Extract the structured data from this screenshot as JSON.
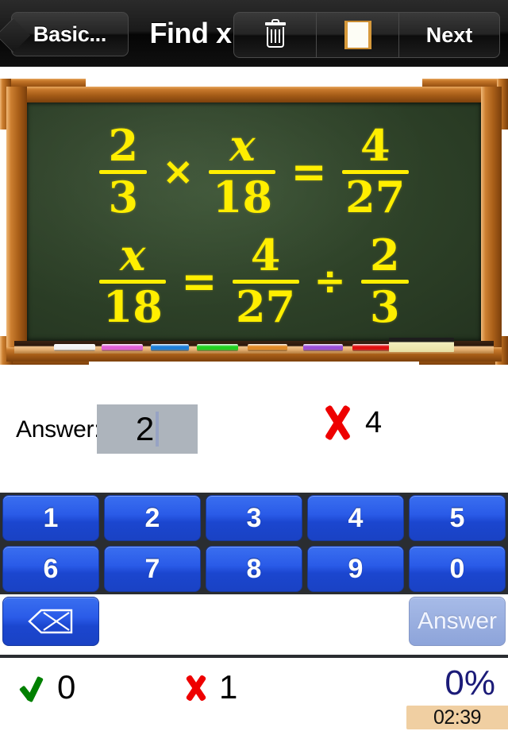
{
  "navbar": {
    "back_label": "Basic...",
    "title": "Find x",
    "trash_icon": "trash-icon",
    "board_icon": "board-icon",
    "next_label": "Next"
  },
  "chalkboard": {
    "equations": [
      {
        "terms": [
          {
            "kind": "fraction",
            "numerator": "2",
            "denominator": "3"
          },
          {
            "kind": "operator",
            "symbol": "×"
          },
          {
            "kind": "fraction",
            "numerator": "x",
            "denominator": "18",
            "numerator_italic": true
          },
          {
            "kind": "operator",
            "symbol": "="
          },
          {
            "kind": "fraction",
            "numerator": "4",
            "denominator": "27"
          }
        ]
      },
      {
        "terms": [
          {
            "kind": "fraction",
            "numerator": "x",
            "denominator": "18",
            "numerator_italic": true
          },
          {
            "kind": "operator",
            "symbol": "="
          },
          {
            "kind": "fraction",
            "numerator": "4",
            "denominator": "27"
          },
          {
            "kind": "operator",
            "symbol": "÷"
          },
          {
            "kind": "fraction",
            "numerator": "2",
            "denominator": "3"
          }
        ]
      }
    ],
    "chalk_colors": [
      "#f2f2f2",
      "#e060d8",
      "#1e7fd8",
      "#21d021",
      "#e08a28",
      "#9b4fd8",
      "#e01010"
    ],
    "eraser_color": "#f2edbe",
    "board_color": "#2f4329",
    "chalk_text_color": "#ffee00"
  },
  "answer_row": {
    "label": "Answer:",
    "value": "2",
    "result_icon": "x-mark-icon",
    "correct_answer": "4",
    "box_color": "#adb4bc"
  },
  "keypad": {
    "row1": [
      "1",
      "2",
      "3",
      "4",
      "5"
    ],
    "row2": [
      "6",
      "7",
      "8",
      "9",
      "0"
    ],
    "backspace_icon": "backspace-icon",
    "answer_label": "Answer",
    "key_color": "#2a5be8",
    "answer_key_color": "#9aafe0"
  },
  "status": {
    "correct_icon": "check-icon",
    "correct_count": "0",
    "wrong_icon": "x-mark-icon",
    "wrong_count": "1",
    "percent": "0%",
    "percent_color": "#1b1b78",
    "timer": "02:39",
    "timer_bg": "#f0cfa2"
  }
}
